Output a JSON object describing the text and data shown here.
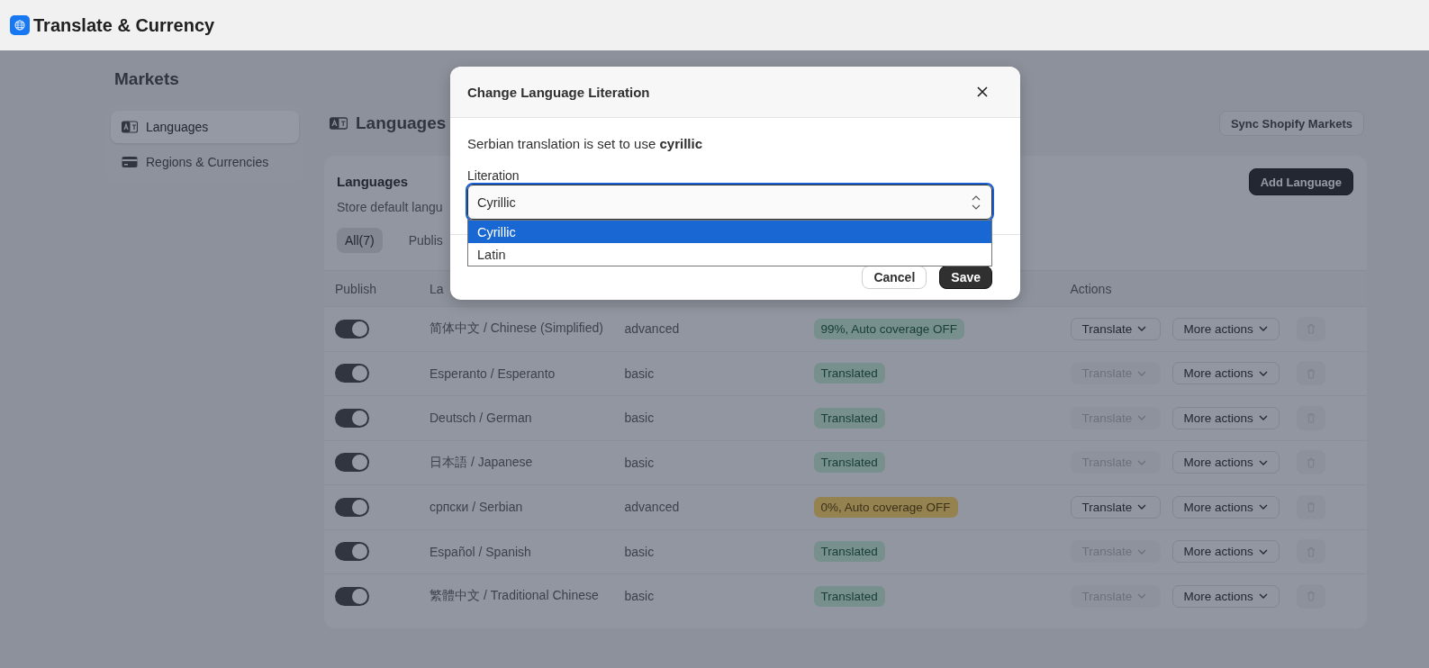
{
  "app": {
    "title": "Translate & Currency"
  },
  "sidebar": {
    "title": "Markets",
    "items": [
      {
        "label": "Languages",
        "selected": true
      },
      {
        "label": "Regions & Currencies",
        "selected": false
      }
    ]
  },
  "page": {
    "title": "Languages",
    "sync_button": "Sync Shopify Markets"
  },
  "card": {
    "title": "Languages",
    "subtitle": "Store default langu",
    "add_button": "Add Language",
    "tabs": [
      {
        "label": "All(7)",
        "selected": true
      },
      {
        "label": "Publis",
        "selected": false
      }
    ],
    "columns": [
      "Publish",
      "La",
      "Actions"
    ],
    "rows": [
      {
        "published": true,
        "language": "简体中文 / Chinese (Simplified)",
        "type": "advanced",
        "status": {
          "text": "99%, Auto coverage OFF",
          "kind": "success"
        },
        "translate": {
          "label": "Translate",
          "disabled": false
        },
        "more_actions": "More actions"
      },
      {
        "published": true,
        "language": "Esperanto / Esperanto",
        "type": "basic",
        "status": {
          "text": "Translated",
          "kind": "success"
        },
        "translate": {
          "label": "Translate",
          "disabled": true
        },
        "more_actions": "More actions"
      },
      {
        "published": true,
        "language": "Deutsch / German",
        "type": "basic",
        "status": {
          "text": "Translated",
          "kind": "success"
        },
        "translate": {
          "label": "Translate",
          "disabled": true
        },
        "more_actions": "More actions"
      },
      {
        "published": true,
        "language": "日本語 / Japanese",
        "type": "basic",
        "status": {
          "text": "Translated",
          "kind": "success"
        },
        "translate": {
          "label": "Translate",
          "disabled": true
        },
        "more_actions": "More actions"
      },
      {
        "published": true,
        "language": "српски / Serbian",
        "type": "advanced",
        "status": {
          "text": "0%, Auto coverage OFF",
          "kind": "warning"
        },
        "translate": {
          "label": "Translate",
          "disabled": false
        },
        "more_actions": "More actions"
      },
      {
        "published": true,
        "language": "Español / Spanish",
        "type": "basic",
        "status": {
          "text": "Translated",
          "kind": "success"
        },
        "translate": {
          "label": "Translate",
          "disabled": true
        },
        "more_actions": "More actions"
      },
      {
        "published": true,
        "language": "繁體中文 / Traditional Chinese",
        "type": "basic",
        "status": {
          "text": "Translated",
          "kind": "success"
        },
        "translate": {
          "label": "Translate",
          "disabled": true
        },
        "more_actions": "More actions"
      }
    ]
  },
  "modal": {
    "title": "Change Language Literation",
    "message": "Serbian translation is set to use **cyrillic**",
    "field_label": "Literation",
    "value": "Cyrillic",
    "options": [
      {
        "label": "Cyrillic",
        "selected": true
      },
      {
        "label": "Latin",
        "selected": false
      }
    ],
    "buttons": [
      {
        "label": "Cancel",
        "kind": "secondary"
      },
      {
        "label": "Save",
        "kind": "primary"
      }
    ]
  }
}
